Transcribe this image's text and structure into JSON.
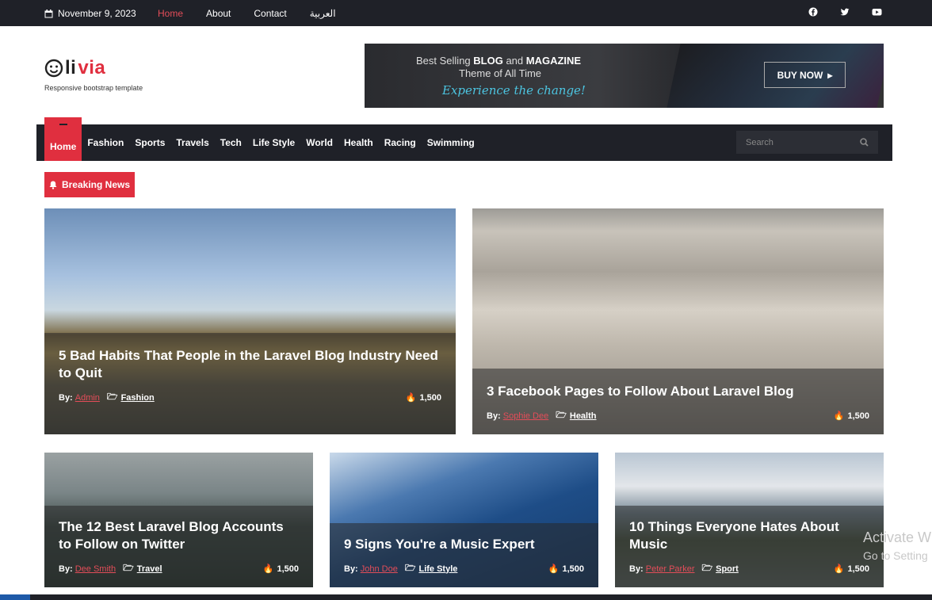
{
  "topbar": {
    "date": "November 9, 2023",
    "nav": [
      "Home",
      "About",
      "Contact",
      "العربية"
    ],
    "active_nav": "Home",
    "social_icons": [
      "facebook-icon",
      "twitter-icon",
      "youtube-icon"
    ]
  },
  "header": {
    "logo_text_1": "li",
    "logo_text_2": "via",
    "tagline": "Responsive bootstrap template",
    "banner": {
      "line1_prefix": "Best Selling ",
      "line1_b1": "BLOG",
      "line1_mid": " and ",
      "line1_b2": "MAGAZINE",
      "line2": "Theme of All Time",
      "line3": "Experience the change!",
      "buy_label": "BUY NOW"
    }
  },
  "mainnav": {
    "items": [
      "Home",
      "Fashion",
      "Sports",
      "Travels",
      "Tech",
      "Life Style",
      "World",
      "Health",
      "Racing",
      "Swimming"
    ],
    "active": "Home",
    "search_placeholder": "Search"
  },
  "breaking": {
    "label": "Breaking News"
  },
  "cards": [
    {
      "title": "5 Bad Habits That People in the Laravel Blog Industry Need to Quit",
      "by": "By:",
      "author": "Admin",
      "category": "Fashion",
      "views": "1,500"
    },
    {
      "title": "3 Facebook Pages to Follow About Laravel Blog",
      "by": "By:",
      "author": "Sophie Dee",
      "category": "Health",
      "views": "1,500"
    },
    {
      "title": "The 12 Best Laravel Blog Accounts to Follow on Twitter",
      "by": "By:",
      "author": "Dee Smith",
      "category": "Travel",
      "views": "1,500"
    },
    {
      "title": "9 Signs You're a Music Expert",
      "by": "By:",
      "author": "John Doe",
      "category": "Life Style",
      "views": "1,500"
    },
    {
      "title": "10 Things Everyone Hates About Music",
      "by": "By:",
      "author": "Peter Parker",
      "category": "Sport",
      "views": "1,500"
    }
  ],
  "watermark": {
    "line1": "Activate W",
    "line2": "Go to Setting"
  },
  "colors": {
    "accent": "#e02f3f",
    "dark": "#1f2128"
  }
}
